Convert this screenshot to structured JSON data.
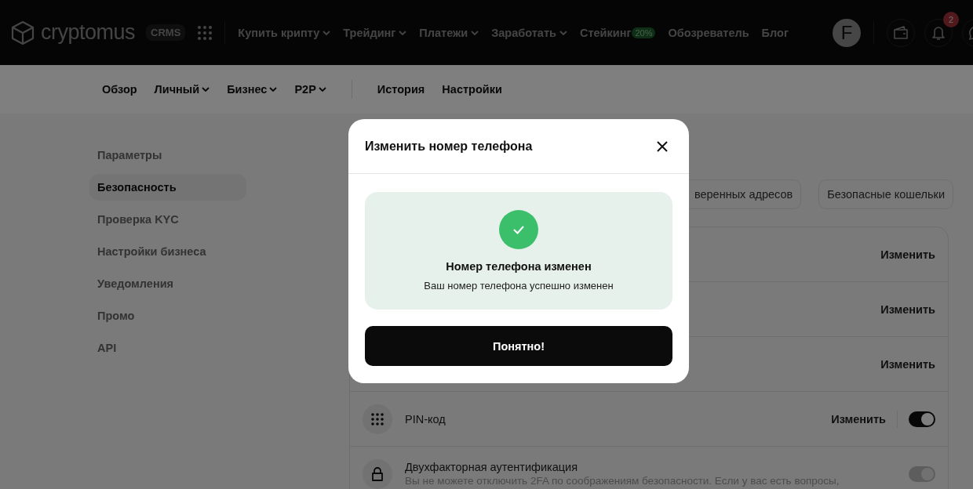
{
  "header": {
    "logo": "cryptomus",
    "logo_badge": "CRMS",
    "nav": [
      {
        "label": "Купить крипту",
        "dropdown": true
      },
      {
        "label": "Трейдинг",
        "dropdown": true
      },
      {
        "label": "Платежи",
        "dropdown": true
      },
      {
        "label": "Заработать",
        "dropdown": true
      },
      {
        "label": "Стейкинг",
        "dropdown": false,
        "badge": "20%"
      },
      {
        "label": "Обозреватель",
        "dropdown": false
      },
      {
        "label": "Блог",
        "dropdown": false
      }
    ],
    "avatar": "F",
    "notifications": "2"
  },
  "subnav": [
    {
      "label": "Обзор",
      "dropdown": false
    },
    {
      "label": "Личный",
      "dropdown": true
    },
    {
      "label": "Бизнес",
      "dropdown": true
    },
    {
      "label": "P2P",
      "dropdown": true
    },
    {
      "label": "История",
      "dropdown": false,
      "divider_before": true
    },
    {
      "label": "Настройки",
      "dropdown": false
    }
  ],
  "sidebar": {
    "items": [
      {
        "label": "Параметры",
        "selected": false
      },
      {
        "label": "Безопасность",
        "selected": true
      },
      {
        "label": "Проверка KYC",
        "selected": false
      },
      {
        "label": "Настройки бизнеса",
        "selected": false
      },
      {
        "label": "Уведомления",
        "selected": false
      },
      {
        "label": "Промо",
        "selected": false
      },
      {
        "label": "API",
        "selected": false
      }
    ]
  },
  "tabs": [
    {
      "label": "веренных адресов"
    },
    {
      "label": "Безопасные кошельки"
    }
  ],
  "settings": [
    {
      "kind": "action",
      "action": "Изменить"
    },
    {
      "kind": "action",
      "action": "Изменить"
    },
    {
      "kind": "action",
      "action": "Изменить"
    },
    {
      "kind": "keypad",
      "label": "PIN-код",
      "action": "Изменить",
      "on": true,
      "disabled": false
    },
    {
      "kind": "lock",
      "label": "Двухфакторная аутентификация",
      "description": "Вы не можете отключить 2FA по соображениям безопасности. Если у вас есть вопросы,",
      "on": true,
      "disabled": true
    }
  ],
  "modal": {
    "title": "Изменить номер телефона",
    "success_title": "Номер телефона изменен",
    "success_text": "Ваш номер телефона успешно изменен",
    "button": "Понятно!"
  }
}
